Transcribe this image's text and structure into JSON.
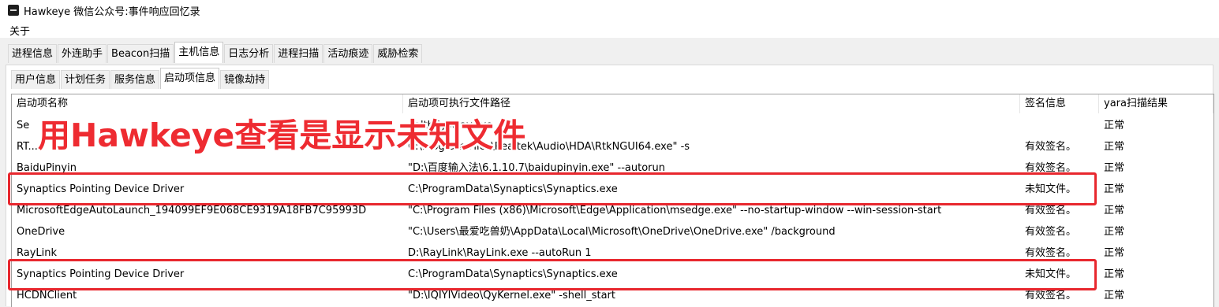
{
  "window": {
    "title": "Hawkeye 微信公众号:事件响应回忆录"
  },
  "menu": {
    "about": "关于"
  },
  "main_tabs": [
    "进程信息",
    "外连助手",
    "Beacon扫描",
    "主机信息",
    "日志分析",
    "进程扫描",
    "活动痕迹",
    "威胁检索"
  ],
  "main_tab_active": 3,
  "sub_tabs": [
    "用户信息",
    "计划任务",
    "服务信息",
    "启动项信息",
    "镜像劫持"
  ],
  "sub_tab_active": 3,
  "table": {
    "headers": [
      "启动项名称",
      "启动项可执行文件路径",
      "签名信息",
      "yara扫描结果"
    ],
    "rows": [
      [
        "Se",
        "ealthSystray.exe",
        "",
        "正常"
      ],
      [
        "RT...",
        "C:\\Program Files\\Realtek\\Audio\\HDA\\RtkNGUI64.exe\" -s",
        "有效签名。",
        "正常"
      ],
      [
        "BaiduPinyin",
        "\"D:\\百度输入法\\6.1.10.7\\baidupinyin.exe\" --autorun",
        "有效签名。",
        "正常"
      ],
      [
        "Synaptics Pointing Device Driver",
        "C:\\ProgramData\\Synaptics\\Synaptics.exe",
        "未知文件。",
        "正常"
      ],
      [
        "MicrosoftEdgeAutoLaunch_194099EF9E068CE9319A18FB7C95993D",
        "\"C:\\Program Files (x86)\\Microsoft\\Edge\\Application\\msedge.exe\" --no-startup-window --win-session-start",
        "有效签名。",
        "正常"
      ],
      [
        "OneDrive",
        "\"C:\\Users\\最爱吃兽奶\\AppData\\Local\\Microsoft\\OneDrive\\OneDrive.exe\" /background",
        "有效签名。",
        "正常"
      ],
      [
        "RayLink",
        "D:\\RayLink\\RayLink.exe --autoRun 1",
        "有效签名。",
        "正常"
      ],
      [
        "Synaptics Pointing Device Driver",
        "C:\\ProgramData\\Synaptics\\Synaptics.exe",
        "未知文件。",
        "正常"
      ],
      [
        "HCDNClient",
        "\"D:\\IQIYIVideo\\QyKernel.exe\" -shell_start",
        "有效签名。",
        "正常"
      ]
    ]
  },
  "annotation": {
    "text": "用Hawkeye查看是显示未知文件",
    "color": "#e8272e"
  }
}
